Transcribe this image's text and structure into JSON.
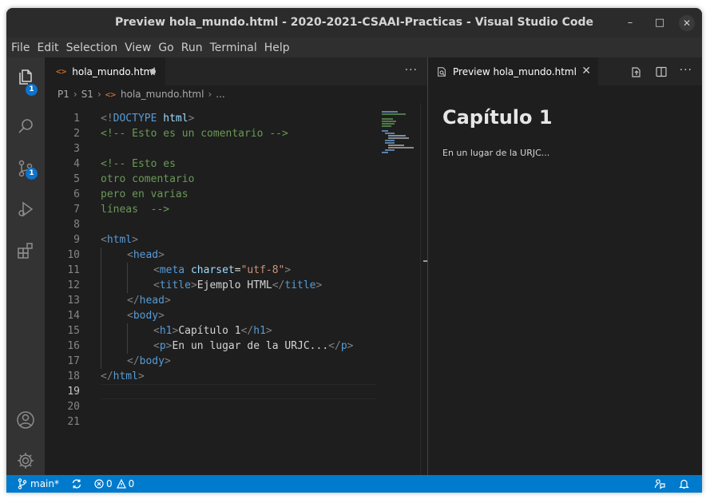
{
  "window": {
    "title": "Preview hola_mundo.html - 2020-2021-CSAAI-Practicas - Visual Studio Code",
    "controls": {
      "minimize": "–",
      "maximize": "□",
      "close": "✕"
    }
  },
  "menu": [
    "File",
    "Edit",
    "Selection",
    "View",
    "Go",
    "Run",
    "Terminal",
    "Help"
  ],
  "activity": {
    "explorer_badge": "1",
    "scm_badge": "1"
  },
  "editor": {
    "tab": {
      "label": "hola_mundo.html",
      "icon": "<>",
      "more": "···"
    },
    "breadcrumb": {
      "p1": "P1",
      "s1": "S1",
      "file": "hola_mundo.html",
      "ellipsis": "..."
    },
    "active_line": 19,
    "line_numbers": [
      "1",
      "2",
      "3",
      "4",
      "5",
      "6",
      "7",
      "8",
      "9",
      "10",
      "11",
      "12",
      "13",
      "14",
      "15",
      "16",
      "17",
      "18",
      "19",
      "20",
      "21"
    ],
    "code": {
      "l1_a": "<!",
      "l1_b": "DOCTYPE",
      "l1_c": " ",
      "l1_d": "html",
      "l1_e": ">",
      "l2": "<!-- Esto es un comentario -->",
      "l4": "<!-- Esto es",
      "l5": "otro comentario",
      "l6": "pero en varias",
      "l7": "líneas  -->",
      "lt": "<",
      "gt": ">",
      "lts": "</",
      "html": "html",
      "head": "head",
      "meta": "meta",
      "charset": "charset",
      "eq": "=",
      "utf8": "\"utf-8\"",
      "title": "title",
      "title_text": "Ejemplo HTML",
      "body": "body",
      "h1": "h1",
      "h1_text": "Capítulo 1",
      "p": "p",
      "p_text": "En un lugar de la URJC..."
    }
  },
  "preview": {
    "tab": {
      "label": "Preview hola_mundo.html",
      "close": "✕",
      "more": "···"
    },
    "heading": "Capítulo 1",
    "paragraph": "En un lugar de la URJC..."
  },
  "status": {
    "branch": "main*",
    "errors": "0",
    "warnings": "0"
  },
  "colors": {
    "status_bar": "#007acc",
    "badge": "#0e73cc",
    "html_icon": "#e37933",
    "tag": "#569cd6",
    "attribute": "#9cdcfe",
    "string": "#ce9178",
    "comment": "#6a9955"
  }
}
